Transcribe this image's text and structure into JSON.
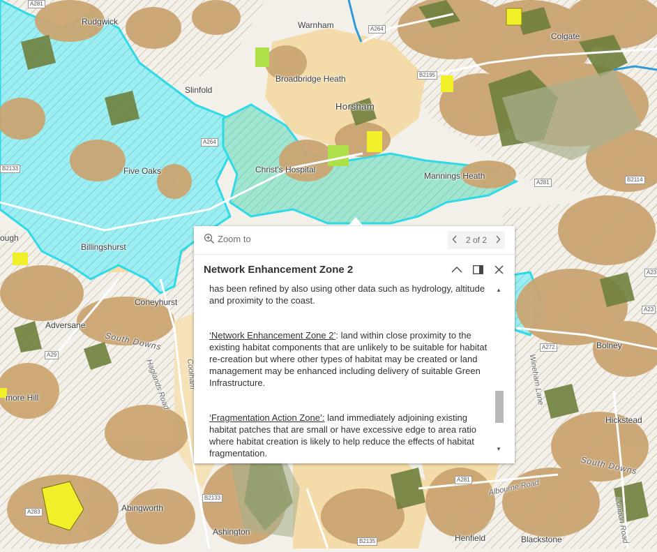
{
  "map": {
    "places": [
      {
        "id": "rudgwick",
        "name": "Rudgwick"
      },
      {
        "id": "warnham",
        "name": "Warnham"
      },
      {
        "id": "broadbridge-heath",
        "name": "Broadbridge Heath"
      },
      {
        "id": "horsham",
        "name": "Horsham"
      },
      {
        "id": "slinfold",
        "name": "Slinfold"
      },
      {
        "id": "christs-hospital",
        "name": "Christ's Hospital"
      },
      {
        "id": "mannings-heath",
        "name": "Mannings Heath"
      },
      {
        "id": "colgate",
        "name": "Colgate"
      },
      {
        "id": "five-oaks",
        "name": "Five Oaks"
      },
      {
        "id": "billingshurst",
        "name": "Billingshurst"
      },
      {
        "id": "coneyhurst",
        "name": "Coneyhurst"
      },
      {
        "id": "adversane",
        "name": "Adversane"
      },
      {
        "id": "south-downs-1",
        "name": "South Downs"
      },
      {
        "id": "south-downs-2",
        "name": "South Downs"
      },
      {
        "id": "hickstead",
        "name": "Hickstead"
      },
      {
        "id": "bolney",
        "name": "Bolney"
      },
      {
        "id": "abingworth",
        "name": "Abingworth"
      },
      {
        "id": "ashington",
        "name": "Ashington"
      },
      {
        "id": "henfield",
        "name": "Henfield"
      },
      {
        "id": "blackstone",
        "name": "Blackstone"
      },
      {
        "id": "marehill",
        "name": "more Hill"
      },
      {
        "id": "borough",
        "name": "ough"
      },
      {
        "id": "haglands-road",
        "name": "Haglands Road"
      },
      {
        "id": "wineham-lane",
        "name": "Wineham Lane"
      },
      {
        "id": "albourne-road",
        "name": "Albourne Road"
      },
      {
        "id": "london-road",
        "name": "London Road"
      },
      {
        "id": "coolham",
        "name": "Coolham"
      }
    ],
    "road_shields": [
      "A281",
      "A264",
      "B2195",
      "B2133",
      "A264",
      "B2114",
      "A281",
      "A272",
      "A29",
      "B2133",
      "A23",
      "A283",
      "B2135",
      "A281",
      "A23"
    ]
  },
  "popup": {
    "zoom_to": "Zoom to",
    "pager": "2 of 2",
    "title": "Network Enhancement Zone 2",
    "para1": "has been refined by also using other data such as hydrology, altitude and proximity to the coast.",
    "term2": "‘Network Enhancement Zone 2’",
    "para2": ": land within close proximity to the existing habitat components that are unlikely to be suitable for habitat re-creation but where other types of habitat may be created or land management may be enhanced including delivery of suitable Green Infrastructure.",
    "term3": "‘Fragmentation Action Zone’:",
    "para3": " land immediately adjoining existing habitat patches that are small or have excessive edge to area ratio where habitat creation is likely to help reduce the effects of habitat fragmentation.",
    "icons": {
      "collapse": "chevron-up-icon",
      "dock": "dock-icon",
      "close": "close-icon",
      "zoom": "zoom-in-icon"
    }
  },
  "colors": {
    "base": "#f3f0ea",
    "urban": "#f3dcaa",
    "habitat_tan": "#caa572",
    "habitat_dark": "#6f7f3d",
    "cyan_zone": "#2fd9e6",
    "cyan_fill": "#8ee6ec",
    "teal_zone": "#5cd6b6",
    "yellow": "#f0f02a",
    "lime": "#aee04a",
    "water": "#2f9bd6"
  }
}
